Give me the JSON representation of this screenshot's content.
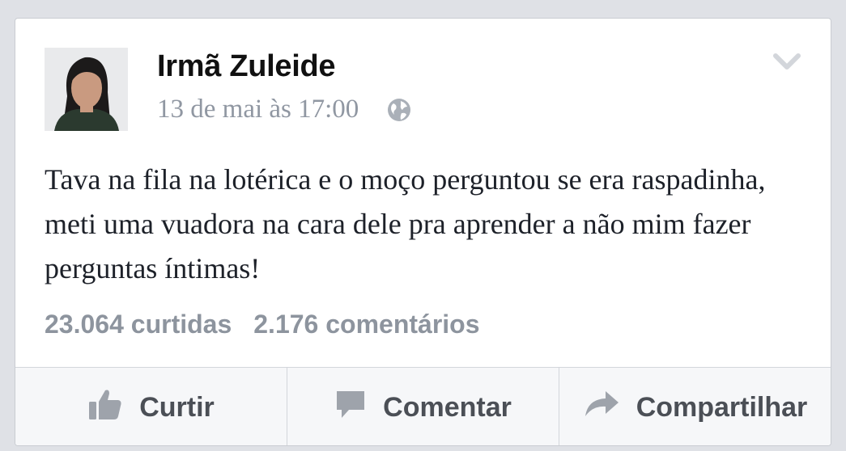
{
  "post": {
    "author": "Irmã Zuleide",
    "timestamp": "13 de mai às 17:00",
    "text": "Tava na fila na lotérica e o moço perguntou se era raspadinha, meti uma vuadora na cara dele pra aprender a não mim fazer perguntas íntimas!",
    "privacy_icon": "globe-icon",
    "menu_icon": "chevron-down-icon"
  },
  "stats": {
    "likes": "23.064 curtidas",
    "comments": "2.176 comentários"
  },
  "actions": {
    "like": "Curtir",
    "comment": "Comentar",
    "share": "Compartilhar"
  },
  "colors": {
    "page_background": "#dfe1e6",
    "text_primary": "#1d2129",
    "text_muted": "#8d949e",
    "action_text": "#4b4f56"
  }
}
